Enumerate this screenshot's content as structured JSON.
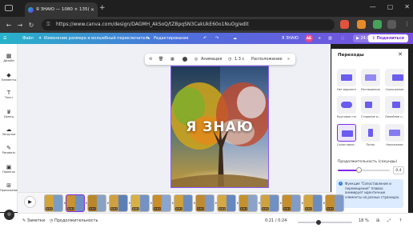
{
  "browser": {
    "tab_title": "Я ЗНАЮ — 1080 × 135(",
    "url": "https://www.canva.com/design/DAGMH_AkSoQ/tZBpqSN3CakUkE60o1NuOg/edit",
    "new_tab_symbol": "+",
    "window_controls": [
      "—",
      "▢",
      "✕"
    ]
  },
  "header": {
    "file_label": "Файл",
    "resize_label": "Изменение размера и волшебный переключатель",
    "editing_label": "Редактирование",
    "design_title": "Я ЗНАЮ",
    "avatar_initials": "АБ",
    "duration_label": "24.0 с",
    "share_label": "Поделиться"
  },
  "sidebar": {
    "items": [
      {
        "label": "Дизайн",
        "icon": "design-icon"
      },
      {
        "label": "Элементы",
        "icon": "elements-icon"
      },
      {
        "label": "Текст",
        "icon": "text-icon"
      },
      {
        "label": "Бренд",
        "icon": "brand-icon"
      },
      {
        "label": "Загрузки",
        "icon": "upload-icon"
      },
      {
        "label": "Рисовать",
        "icon": "draw-icon"
      },
      {
        "label": "Проекты",
        "icon": "projects-icon"
      },
      {
        "label": "Приложения",
        "icon": "apps-icon"
      }
    ]
  },
  "toolbar": {
    "animation_label": "Анимация",
    "timing_label": "1.3 с",
    "position_label": "Расположение",
    "more_symbol": "»"
  },
  "design": {
    "headline": "Я ЗНАЮ"
  },
  "transitions_panel": {
    "title": "Переходы",
    "items": [
      {
        "label": "Нет варианта"
      },
      {
        "label": "Растворение"
      },
      {
        "label": "Скольжение"
      },
      {
        "label": "Круговое стирание"
      },
      {
        "label": "Стирание в..."
      },
      {
        "label": "Линейное с..."
      },
      {
        "label": "Сопоставле...",
        "selected": true
      },
      {
        "label": "Поток"
      },
      {
        "label": "Наложение"
      }
    ],
    "duration_label": "Продолжительность (секунды)",
    "duration_value": "0.4",
    "duration_fraction": 0.4,
    "info_text": "Функция \"Сопоставление и перемещение\" плавно анимирует идентичные элементы на разных страницах."
  },
  "timeline": {
    "play_symbol": "▶",
    "clip_durations": [
      "1.3 с",
      "1.3 с",
      "1.3 с",
      "1.3 с",
      "1.3 с",
      "1.3 с",
      "1.3 с",
      "1.3 с",
      "1.3 с",
      "1.3 с",
      "1.3 с",
      "1.3 с",
      "1.3 с",
      "1.3 с"
    ]
  },
  "bottombar": {
    "notes_label": "Заметки",
    "duration_label": "Продолжительность",
    "time_readout": "0:21 / 0:24",
    "zoom_value": "18 %",
    "zoom_fraction": 0.38
  },
  "colors": {
    "accent": "#7d2ae8",
    "header_start": "#27b3c9",
    "header_end": "#7a4ee0"
  }
}
